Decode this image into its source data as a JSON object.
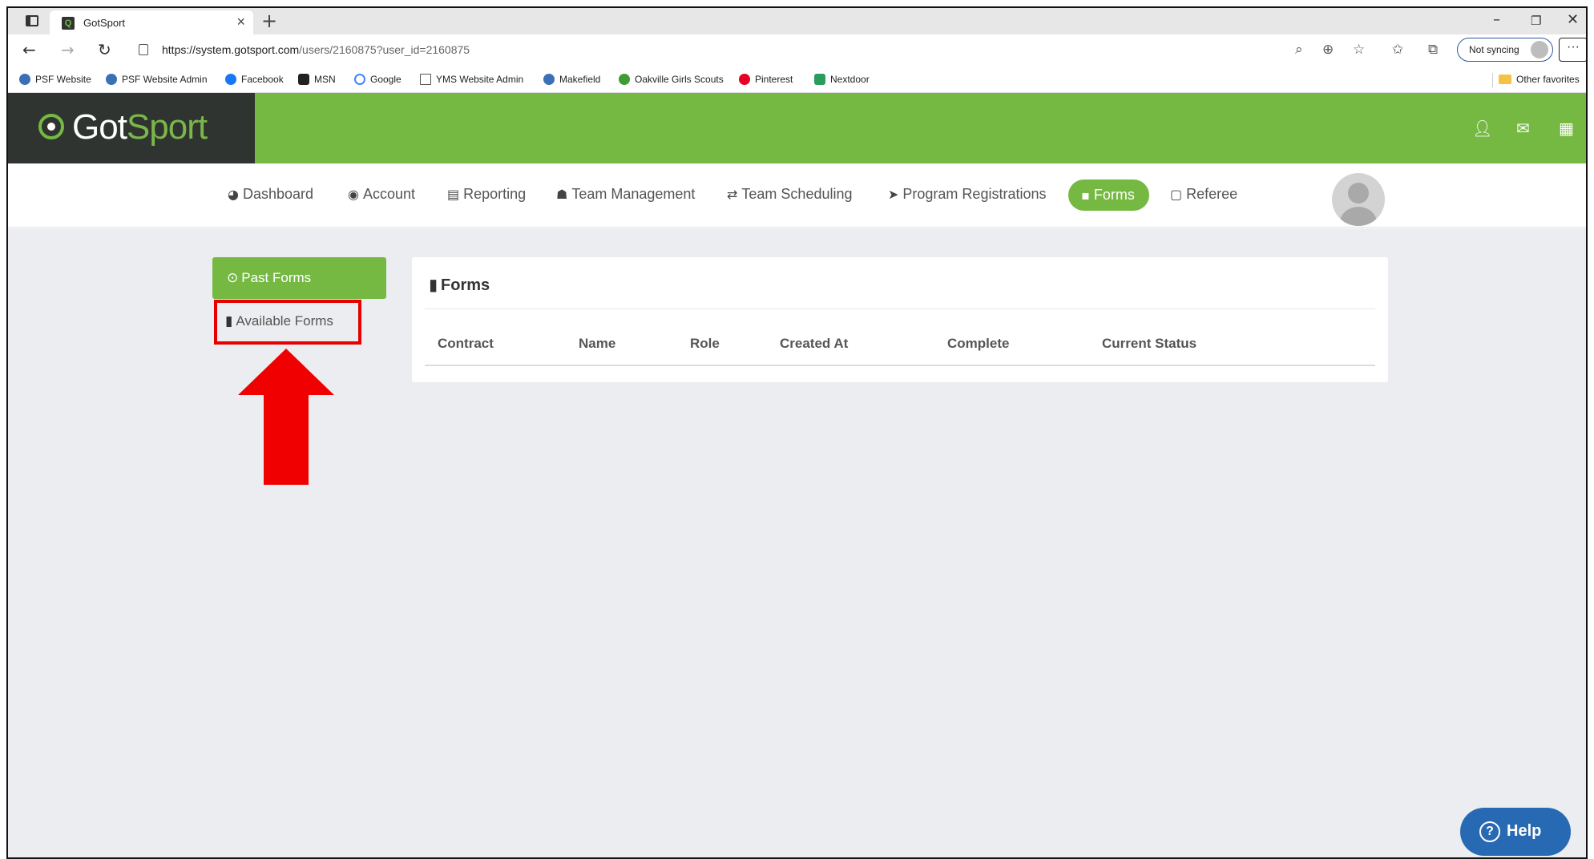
{
  "browser": {
    "tab_title": "GotSport",
    "url_host": "https://system.gotsport.com",
    "url_path": "/users/2160875?user_id=2160875",
    "sync_label": "Not syncing",
    "bookmarks": [
      {
        "label": "PSF Website",
        "color": "#3b6fb6"
      },
      {
        "label": "PSF Website Admin",
        "color": "#3b6fb6"
      },
      {
        "label": "Facebook",
        "color": "#1877f2"
      },
      {
        "label": "MSN",
        "color": "#222222"
      },
      {
        "label": "Google",
        "color": "#ffffff"
      },
      {
        "label": "YMS Website Admin",
        "color": "#ffffff"
      },
      {
        "label": "Makefield",
        "color": "#3b6fb6"
      },
      {
        "label": "Oakville Girls Scouts",
        "color": "#3f9c35"
      },
      {
        "label": "Pinterest",
        "color": "#e60023"
      },
      {
        "label": "Nextdoor",
        "color": "#2a9d5c"
      }
    ],
    "other_favorites": "Other favorites"
  },
  "site": {
    "logo_got": "Got",
    "logo_sport": "Sport",
    "brand_color": "#75b943"
  },
  "nav": {
    "dashboard": "Dashboard",
    "account": "Account",
    "reporting": "Reporting",
    "team_management": "Team Management",
    "team_scheduling": "Team Scheduling",
    "program_registrations": "Program Registrations",
    "forms": "Forms",
    "referee": "Referee"
  },
  "sidebar": {
    "past_forms": "Past Forms",
    "available_forms": "Available Forms"
  },
  "panel": {
    "title": "Forms",
    "columns": [
      "Contract",
      "Name",
      "Role",
      "Created At",
      "Complete",
      "Current Status"
    ]
  },
  "help_label": "Help"
}
